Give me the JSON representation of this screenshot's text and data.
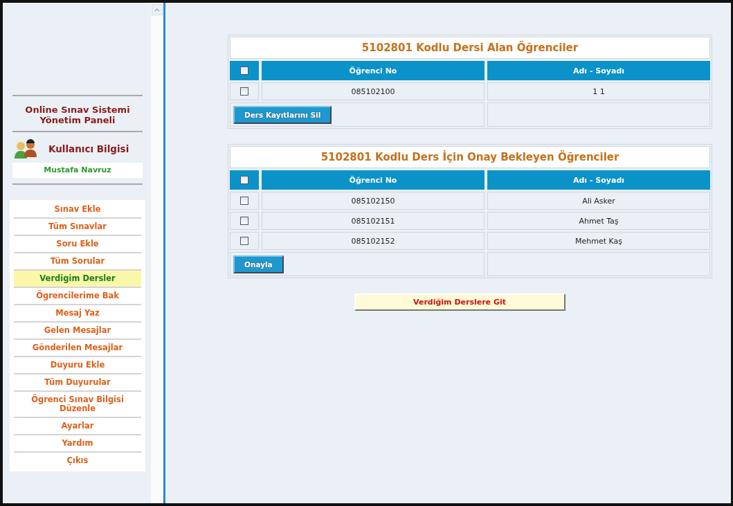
{
  "sidebar": {
    "title_lines": [
      "Online Sınav Sistemi",
      "Yönetim Paneli"
    ],
    "user_heading": "Kullanıcı Bilgisi",
    "user_name": "Mustafa Navruz",
    "menu": [
      {
        "label": "Sınav Ekle",
        "selected": false
      },
      {
        "label": "Tüm Sınavlar",
        "selected": false
      },
      {
        "label": "Soru Ekle",
        "selected": false
      },
      {
        "label": "Tüm Sorular",
        "selected": false
      },
      {
        "label": "Verdigim Dersler",
        "selected": true
      },
      {
        "label": "Ögrencilerime Bak",
        "selected": false
      },
      {
        "label": "Mesaj Yaz",
        "selected": false
      },
      {
        "label": "Gelen Mesajlar",
        "selected": false
      },
      {
        "label": "Gönderilen Mesajlar",
        "selected": false
      },
      {
        "label": "Duyuru Ekle",
        "selected": false
      },
      {
        "label": "Tüm Duyurular",
        "selected": false
      },
      {
        "label": "Ögrenci Sınav Bilgisi Düzenle",
        "selected": false
      },
      {
        "label": "Ayarlar",
        "selected": false
      },
      {
        "label": "Yardım",
        "selected": false
      },
      {
        "label": "Çıkıs",
        "selected": false
      }
    ]
  },
  "tables": [
    {
      "title": "5102801 Kodlu Dersi Alan Öğrenciler",
      "select_all_checked": false,
      "columns": [
        "Öğrenci No",
        "Adı - Soyadı"
      ],
      "rows": [
        {
          "number": "085102100",
          "name": "1 1",
          "checked": false
        }
      ],
      "action_button": "Ders Kayıtlarını Sil"
    },
    {
      "title": "5102801 Kodlu Ders İçin Onay Bekleyen Öğrenciler",
      "select_all_checked": false,
      "columns": [
        "Öğrenci No",
        "Adı - Soyadı"
      ],
      "rows": [
        {
          "number": "085102150",
          "name": "Ali Asker",
          "checked": false
        },
        {
          "number": "085102151",
          "name": "Ahmet Taş",
          "checked": false
        },
        {
          "number": "085102152",
          "name": "Mehmet Kaş",
          "checked": false
        }
      ],
      "action_button": "Onayla"
    }
  ],
  "go_button": "Verdiğim Derslere Git"
}
